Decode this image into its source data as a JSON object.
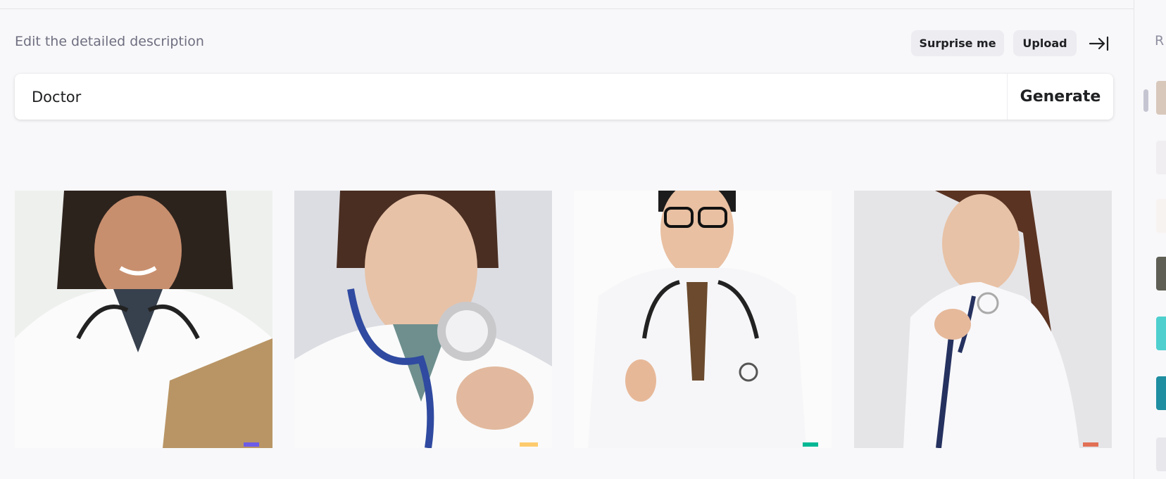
{
  "header": {
    "title": "Edit the detailed description"
  },
  "toolbar": {
    "surprise_label": "Surprise me",
    "upload_label": "Upload",
    "collapse_icon": "collapse-right-icon"
  },
  "prompt": {
    "value": "Doctor",
    "generate_label": "Generate"
  },
  "sidebar": {
    "label": "R"
  },
  "colors": {
    "accent": "#202123",
    "background": "#f8f8fa",
    "pill": "#ececf1",
    "muted": "#6e6e80"
  }
}
